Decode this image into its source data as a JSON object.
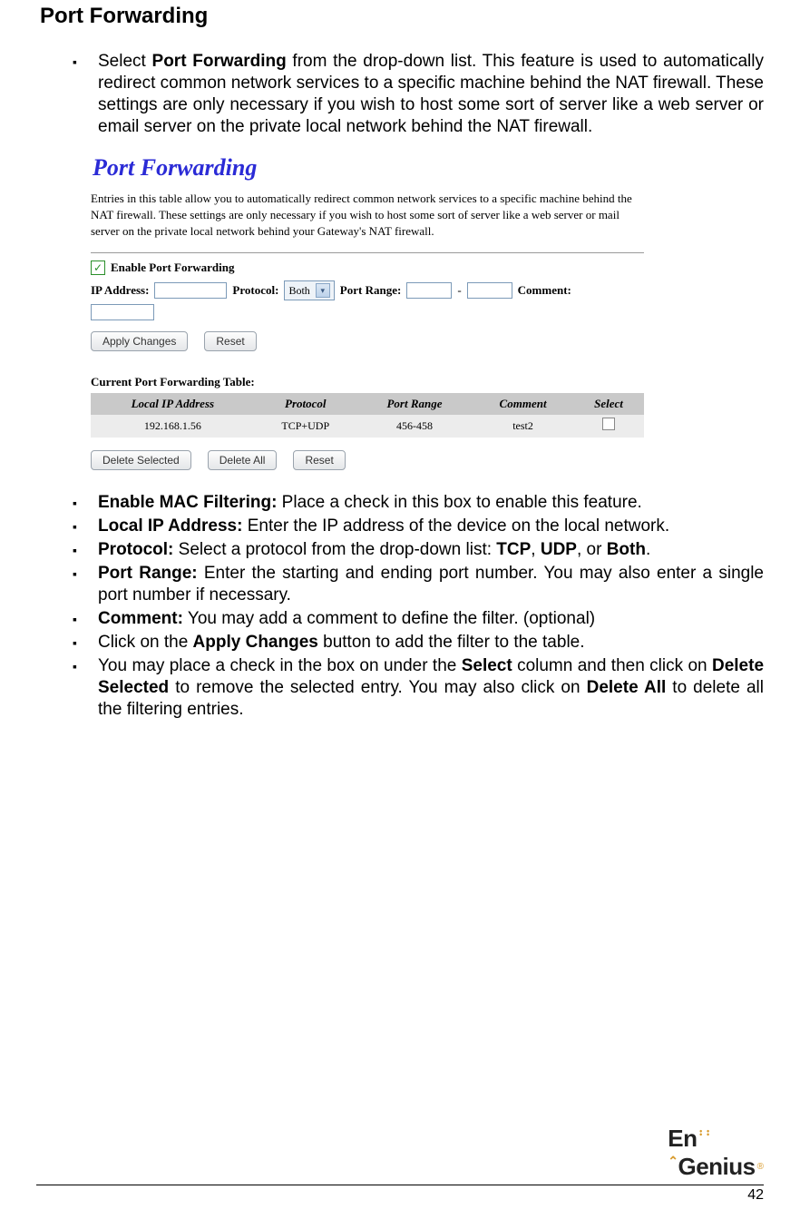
{
  "heading": "Port Forwarding",
  "intro": {
    "prefix": "Select ",
    "bold": "Port Forwarding",
    "suffix": " from the drop-down list. This feature is used to automatically redirect common network services to a specific machine behind the NAT firewall. These settings are only necessary if you wish to host some sort of server like a web server or email server on the private local network behind the NAT firewall."
  },
  "screenshot": {
    "title": "Port Forwarding",
    "description": "Entries in this table allow you to automatically redirect common network services to a specific machine behind the NAT firewall. These settings are only necessary if you wish to host some sort of server like a web server or mail server on the private local network behind your Gateway's NAT firewall.",
    "enable_label": "Enable Port Forwarding",
    "ip_label": "IP Address:",
    "protocol_label": "Protocol:",
    "protocol_value": "Both",
    "portrange_label": "Port Range:",
    "portrange_sep": "-",
    "comment_label": "Comment:",
    "apply_btn": "Apply Changes",
    "reset_btn": "Reset",
    "table_title": "Current Port Forwarding Table:",
    "columns": [
      "Local IP Address",
      "Protocol",
      "Port Range",
      "Comment",
      "Select"
    ],
    "row": {
      "ip": "192.168.1.56",
      "protocol": "TCP+UDP",
      "range": "456-458",
      "comment": "test2"
    },
    "delete_selected_btn": "Delete Selected",
    "delete_all_btn": "Delete All",
    "reset2_btn": "Reset"
  },
  "bullets": {
    "b1": {
      "bold": "Enable MAC Filtering:",
      "rest": " Place a check in this box to enable this feature."
    },
    "b2": {
      "bold": "Local IP Address:",
      "rest": " Enter the IP address of the device on the local network."
    },
    "b3": {
      "bold": "Protocol:",
      "t1": " Select a protocol from the drop-down list: ",
      "tcp": "TCP",
      "c1": ", ",
      "udp": "UDP",
      "c2": ", or ",
      "both": "Both",
      "dot": "."
    },
    "b4": {
      "bold": "Port Range:",
      "rest": " Enter the starting and ending port number. You may also enter a single port number if necessary."
    },
    "b5": {
      "bold": "Comment:",
      "rest": " You may add a comment to define the filter. (optional)"
    },
    "b6": {
      "t1": "Click on the ",
      "bold": "Apply Changes",
      "t2": " button to add the filter to the table."
    },
    "b7": {
      "t1": "You may place a check in the box on under the ",
      "select": "Select",
      "t2": " column and then click on ",
      "ds": "Delete Selected",
      "t3": " to remove the selected entry. You may also click on ",
      "da": "Delete All",
      "t4": " to delete all the filtering entries."
    }
  },
  "footer": {
    "brand_en": "En",
    "brand_genius": "Genius",
    "page": "42"
  }
}
